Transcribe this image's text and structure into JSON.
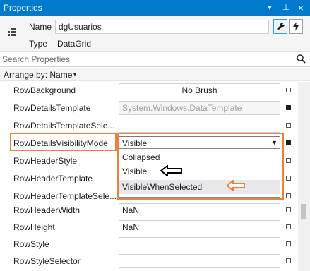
{
  "window": {
    "title": "Properties",
    "buttons": {
      "dropdown": "▾",
      "pin": "⊥",
      "close": "×"
    }
  },
  "header": {
    "name_label": "Name",
    "name_value": "dgUsuarios",
    "type_label": "Type",
    "type_value": "DataGrid",
    "icons": [
      "object-icon",
      "properties-wrench-icon",
      "events-lightning-icon"
    ]
  },
  "search": {
    "placeholder": "Search Properties"
  },
  "arrange": {
    "label": "Arrange by: Name",
    "caret": "▾"
  },
  "properties": [
    {
      "name": "RowBackground",
      "value": "No Brush",
      "marker": "empty"
    },
    {
      "name": "RowDetailsTemplate",
      "value": "System.Windows.DataTemplate",
      "marker": "filled"
    },
    {
      "name": "RowDetailsTemplateSele...",
      "value": "",
      "marker": "empty"
    },
    {
      "name": "RowDetailsVisibilityMode",
      "value": "Visible",
      "marker": "filled"
    },
    {
      "name": "RowHeaderStyle",
      "value": "",
      "marker": "empty"
    },
    {
      "name": "RowHeaderTemplate",
      "value": "",
      "marker": "empty"
    },
    {
      "name": "RowHeaderTemplateSele...",
      "value": "",
      "marker": "empty"
    },
    {
      "name": "RowHeaderWidth",
      "value": "NaN",
      "marker": "empty"
    },
    {
      "name": "RowHeight",
      "value": "NaN",
      "marker": "empty"
    },
    {
      "name": "RowStyle",
      "value": "",
      "marker": "empty"
    },
    {
      "name": "RowStyleSelector",
      "value": "",
      "marker": "empty"
    }
  ],
  "dropdown": {
    "options": [
      "Collapsed",
      "Visible",
      "VisibleWhenSelected"
    ],
    "selected_index": 2
  },
  "colors": {
    "titlebar": "#007acc",
    "highlight": "#f08034",
    "arrow_black": "#000000",
    "arrow_orange": "#f08034"
  }
}
